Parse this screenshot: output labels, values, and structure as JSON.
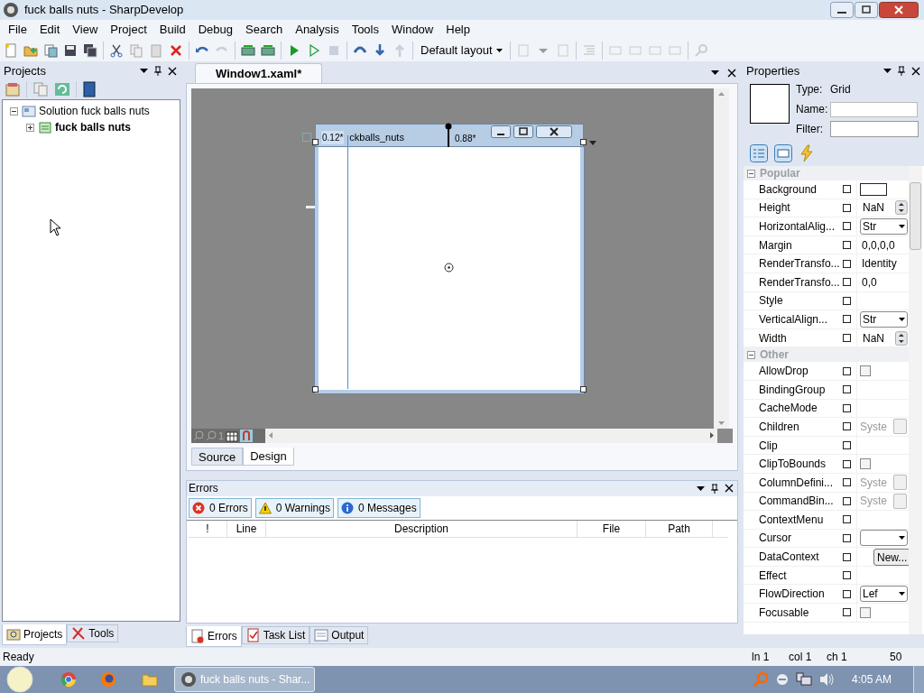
{
  "window": {
    "title": "fuck balls nuts - SharpDevelop"
  },
  "menu": [
    "File",
    "Edit",
    "View",
    "Project",
    "Build",
    "Debug",
    "Search",
    "Analysis",
    "Tools",
    "Window",
    "Help"
  ],
  "toolbar": {
    "layout": "Default layout"
  },
  "projects_pane": {
    "title": "Projects",
    "tree": [
      {
        "label": "Solution fuck balls nuts",
        "kind": "solution",
        "expanded": true,
        "children": [
          {
            "label": "fuck balls nuts",
            "kind": "project",
            "expanded": false
          }
        ]
      }
    ],
    "tabs": [
      {
        "label": "Projects",
        "selected": true
      },
      {
        "label": "Tools",
        "selected": false
      }
    ]
  },
  "document_tabs": [
    {
      "label": "Window1.xaml*",
      "selected": true
    }
  ],
  "designer": {
    "column_labels": [
      "0.12*",
      "0.88*"
    ],
    "window_title": "ckballs_nuts",
    "zoom": "1",
    "view_tabs": [
      {
        "label": "Source",
        "selected": false
      },
      {
        "label": "Design",
        "selected": true
      }
    ]
  },
  "errors_pane": {
    "title": "Errors",
    "filters": [
      {
        "label": "0 Errors",
        "kind": "error"
      },
      {
        "label": "0 Warnings",
        "kind": "warning"
      },
      {
        "label": "0 Messages",
        "kind": "info"
      }
    ],
    "columns": [
      "!",
      "Line",
      "Description",
      "File",
      "Path"
    ],
    "tabs": [
      {
        "label": "Errors",
        "selected": true
      },
      {
        "label": "Task List",
        "selected": false
      },
      {
        "label": "Output",
        "selected": false
      }
    ]
  },
  "properties_pane": {
    "title": "Properties",
    "type_label": "Type:",
    "type_value": "Grid",
    "name_label": "Name:",
    "filter_label": "Filter:",
    "categories": [
      {
        "name": "Popular",
        "expanded": true,
        "properties": [
          {
            "name": "Background",
            "kind": "color"
          },
          {
            "name": "Height",
            "kind": "spin",
            "value": "NaN"
          },
          {
            "name": "HorizontalAlig...",
            "kind": "combo",
            "value": "Str"
          },
          {
            "name": "Margin",
            "kind": "text",
            "value": "0,0,0,0"
          },
          {
            "name": "RenderTransfo...",
            "kind": "text",
            "value": "Identity"
          },
          {
            "name": "RenderTransfo...",
            "kind": "text",
            "value": "0,0"
          },
          {
            "name": "Style",
            "kind": "none"
          },
          {
            "name": "VerticalAlign...",
            "kind": "combo",
            "value": "Str"
          },
          {
            "name": "Width",
            "kind": "spin",
            "value": "NaN"
          }
        ]
      },
      {
        "name": "Other",
        "expanded": true,
        "properties": [
          {
            "name": "AllowDrop",
            "kind": "checkbox",
            "checked": false
          },
          {
            "name": "BindingGroup",
            "kind": "none"
          },
          {
            "name": "CacheMode",
            "kind": "none"
          },
          {
            "name": "Children",
            "kind": "collection",
            "value": "Syste"
          },
          {
            "name": "Clip",
            "kind": "none"
          },
          {
            "name": "ClipToBounds",
            "kind": "checkbox",
            "checked": false
          },
          {
            "name": "ColumnDefini...",
            "kind": "collection",
            "value": "Syste"
          },
          {
            "name": "CommandBin...",
            "kind": "collection",
            "value": "Syste"
          },
          {
            "name": "ContextMenu",
            "kind": "none"
          },
          {
            "name": "Cursor",
            "kind": "combo"
          },
          {
            "name": "DataContext",
            "kind": "button",
            "value": "New..."
          },
          {
            "name": "Effect",
            "kind": "none"
          },
          {
            "name": "FlowDirection",
            "kind": "combo",
            "value": "Lef"
          },
          {
            "name": "Focusable",
            "kind": "checkbox",
            "checked": false
          }
        ]
      }
    ]
  },
  "status_bar": {
    "message": "Ready",
    "line": "ln 1",
    "col": "col 1",
    "ch": "ch 1",
    "zoom": "50"
  },
  "taskbar": {
    "task": "fuck balls nuts - Shar...",
    "clock": "4:05 AM"
  }
}
